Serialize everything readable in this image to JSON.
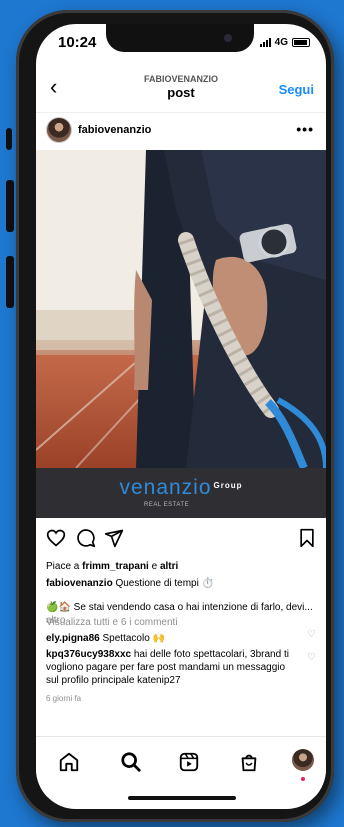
{
  "status": {
    "time": "10:24",
    "network": "4G"
  },
  "nav": {
    "owner": "FABIOVENANZIO",
    "title": "post",
    "follow_label": "Segui"
  },
  "post": {
    "username": "fabiovenanzio"
  },
  "brand": {
    "name": "venanzio",
    "group": "Group",
    "sub": "REAL ESTATE"
  },
  "likes": {
    "prefix": "Piace a ",
    "user": "frimm_trapani",
    "mid": " e ",
    "others": "altri"
  },
  "caption": {
    "user": "fabiovenanzio",
    "text": " Questione di tempi ⏱️",
    "line2": "🍏🏠 Se stai vendendo casa o hai intenzione di farlo, devi...",
    "more": " altro"
  },
  "comments": {
    "view_all": "Visualizza tutti e 6 i commenti",
    "items": [
      {
        "user": "ely.pigna86",
        "text": " Spettacolo 🙌"
      },
      {
        "user": "kpq376ucy938xxc",
        "text": " hai delle foto spettacolari, 3brand ti vogliono pagare per fare post mandami un messaggio sul profilo principale katenip27"
      }
    ]
  },
  "timestamp": "6 giorni fa",
  "colors": {
    "accent": "#1a8cff",
    "brand": "#2f8bd8",
    "background": "#1e78d0"
  },
  "icons": [
    "back-icon",
    "more-icon",
    "heart-icon",
    "comment-icon",
    "share-icon",
    "bookmark-icon",
    "home-icon",
    "search-icon",
    "reels-icon",
    "shop-icon",
    "profile-icon"
  ]
}
